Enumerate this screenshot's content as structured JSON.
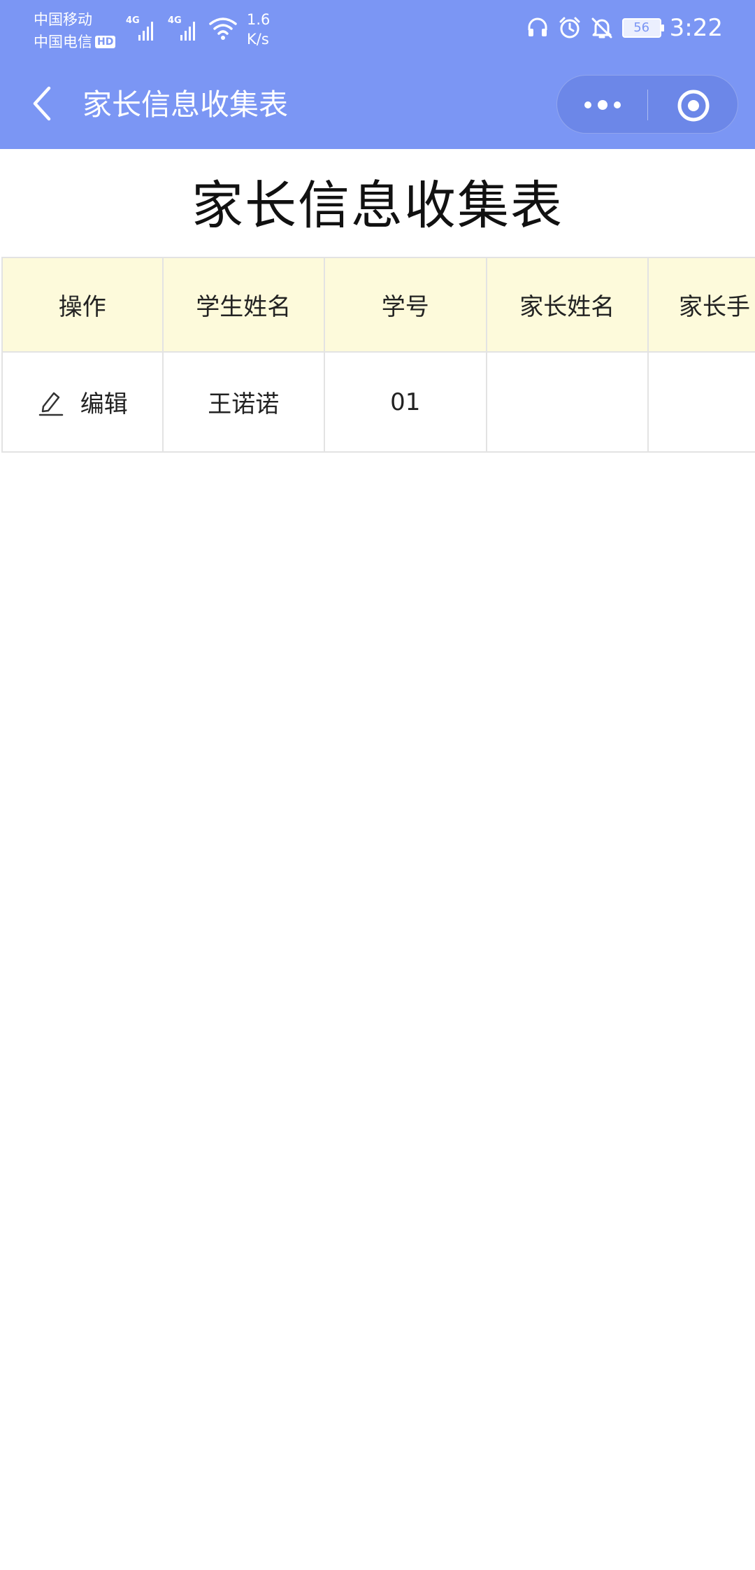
{
  "status_bar": {
    "carrier1": "中国移动",
    "carrier2": "中国电信",
    "hd_badge": "HD",
    "signal1_label": "4G",
    "signal2_label": "4G",
    "net_speed_value": "1.6",
    "net_speed_unit": "K/s",
    "battery": "56",
    "time": "3:22",
    "icons": [
      "headset-icon",
      "alarm-icon",
      "bell-off-icon",
      "battery-icon"
    ]
  },
  "nav_bar": {
    "title": "家长信息收集表",
    "back_icon": "chevron-left-icon",
    "capsule_icons": [
      "more-dots-icon",
      "target-circle-icon"
    ]
  },
  "page": {
    "title": "家长信息收集表"
  },
  "table": {
    "columns": [
      "操作",
      "学生姓名",
      "学号",
      "家长姓名",
      "家长手"
    ],
    "rows": [
      {
        "action_label": "编辑",
        "action_icon": "edit-pencil-icon",
        "student_name": "王诺诺",
        "student_id": "01",
        "parent_name": "",
        "parent_phone": ""
      }
    ]
  },
  "colors": {
    "header_blue": "#7b96f4",
    "table_header_bg": "#fdfadb",
    "grid_line": "#e3e3e3"
  }
}
